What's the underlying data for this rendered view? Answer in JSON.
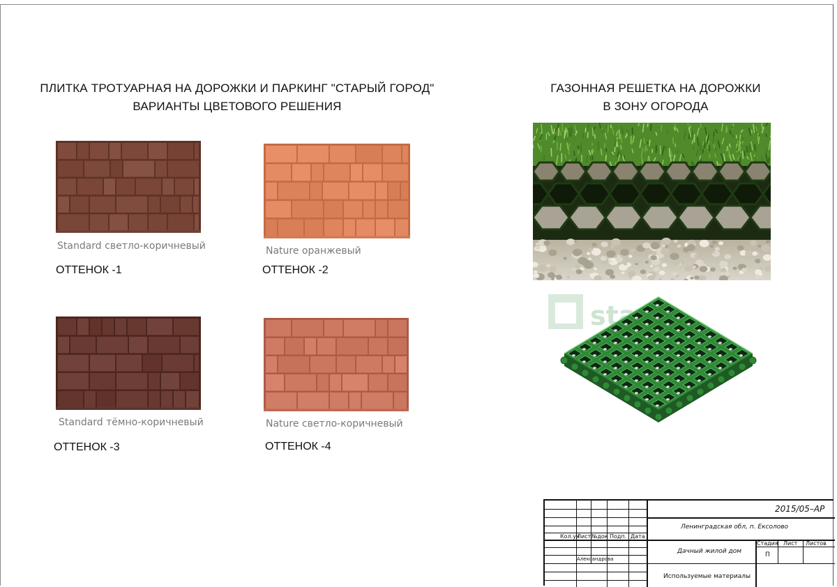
{
  "left_heading": {
    "line1": "ПЛИТКА ТРОТУАРНАЯ НА ДОРОЖКИ И ПАРКИНГ  \"СТАРЫЙ ГОРОД\"",
    "line2": "ВАРИАНТЫ ЦВЕТОВОГО РЕШЕНИЯ"
  },
  "right_heading": {
    "line1": "ГАЗОННАЯ РЕШЕТКА НА ДОРОЖКИ",
    "line2": "В ЗОНУ ОГОРОДА"
  },
  "samples": [
    {
      "caption": "Standard светло-коричневый",
      "shade": "ОТТЕНОК -1",
      "color": "#7e4a3c",
      "mortar": "#5e3228"
    },
    {
      "caption": "Nature оранжевый",
      "shade": "ОТТЕНОК -2",
      "color": "#e0875f",
      "mortar": "#c46a46"
    },
    {
      "caption": "Standard тёмно-коричневый",
      "shade": "ОТТЕНОК -3",
      "color": "#6a3b32",
      "mortar": "#4c2520"
    },
    {
      "caption": "Nature светло-коричневый",
      "shade": "ОТТЕНОК -4",
      "color": "#cf7a62",
      "mortar": "#ad5a46"
    }
  ],
  "watermark": "stari",
  "title_block": {
    "code": "2015/05–АР",
    "location": "Ленинградская обл,  п. Ексолово",
    "cols": [
      "Кол.уч",
      "Лист",
      "№док",
      "Подп.",
      "Дата"
    ],
    "stage_label": "Стадия",
    "sheet_label": "Лист",
    "sheets_label": "Листов",
    "stage_value": "П",
    "author": "Александрова",
    "project": "Дачный жилой дом",
    "sheet_title": "Используемые материалы"
  }
}
